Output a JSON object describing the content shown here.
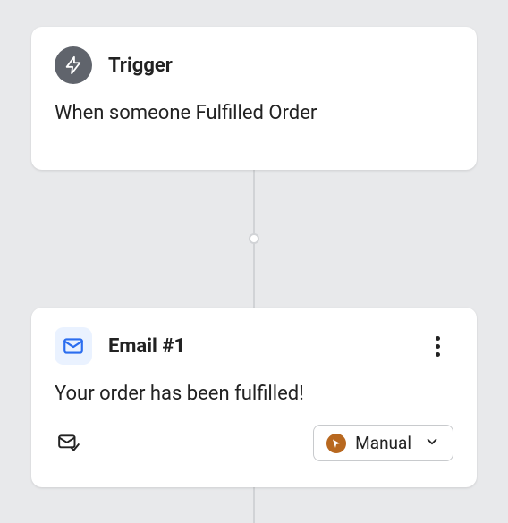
{
  "trigger": {
    "title": "Trigger",
    "description": "When someone Fulfilled Order"
  },
  "email": {
    "title": "Email #1",
    "subject": "Your order has been fulfilled!",
    "mode": {
      "label": "Manual",
      "badge_color": "#b8681f"
    }
  },
  "icons": {
    "trigger": "lightning",
    "email": "envelope",
    "status": "envelope-check",
    "mode_badge": "cursor",
    "more": "dots-vertical",
    "dropdown": "chevron-down"
  }
}
